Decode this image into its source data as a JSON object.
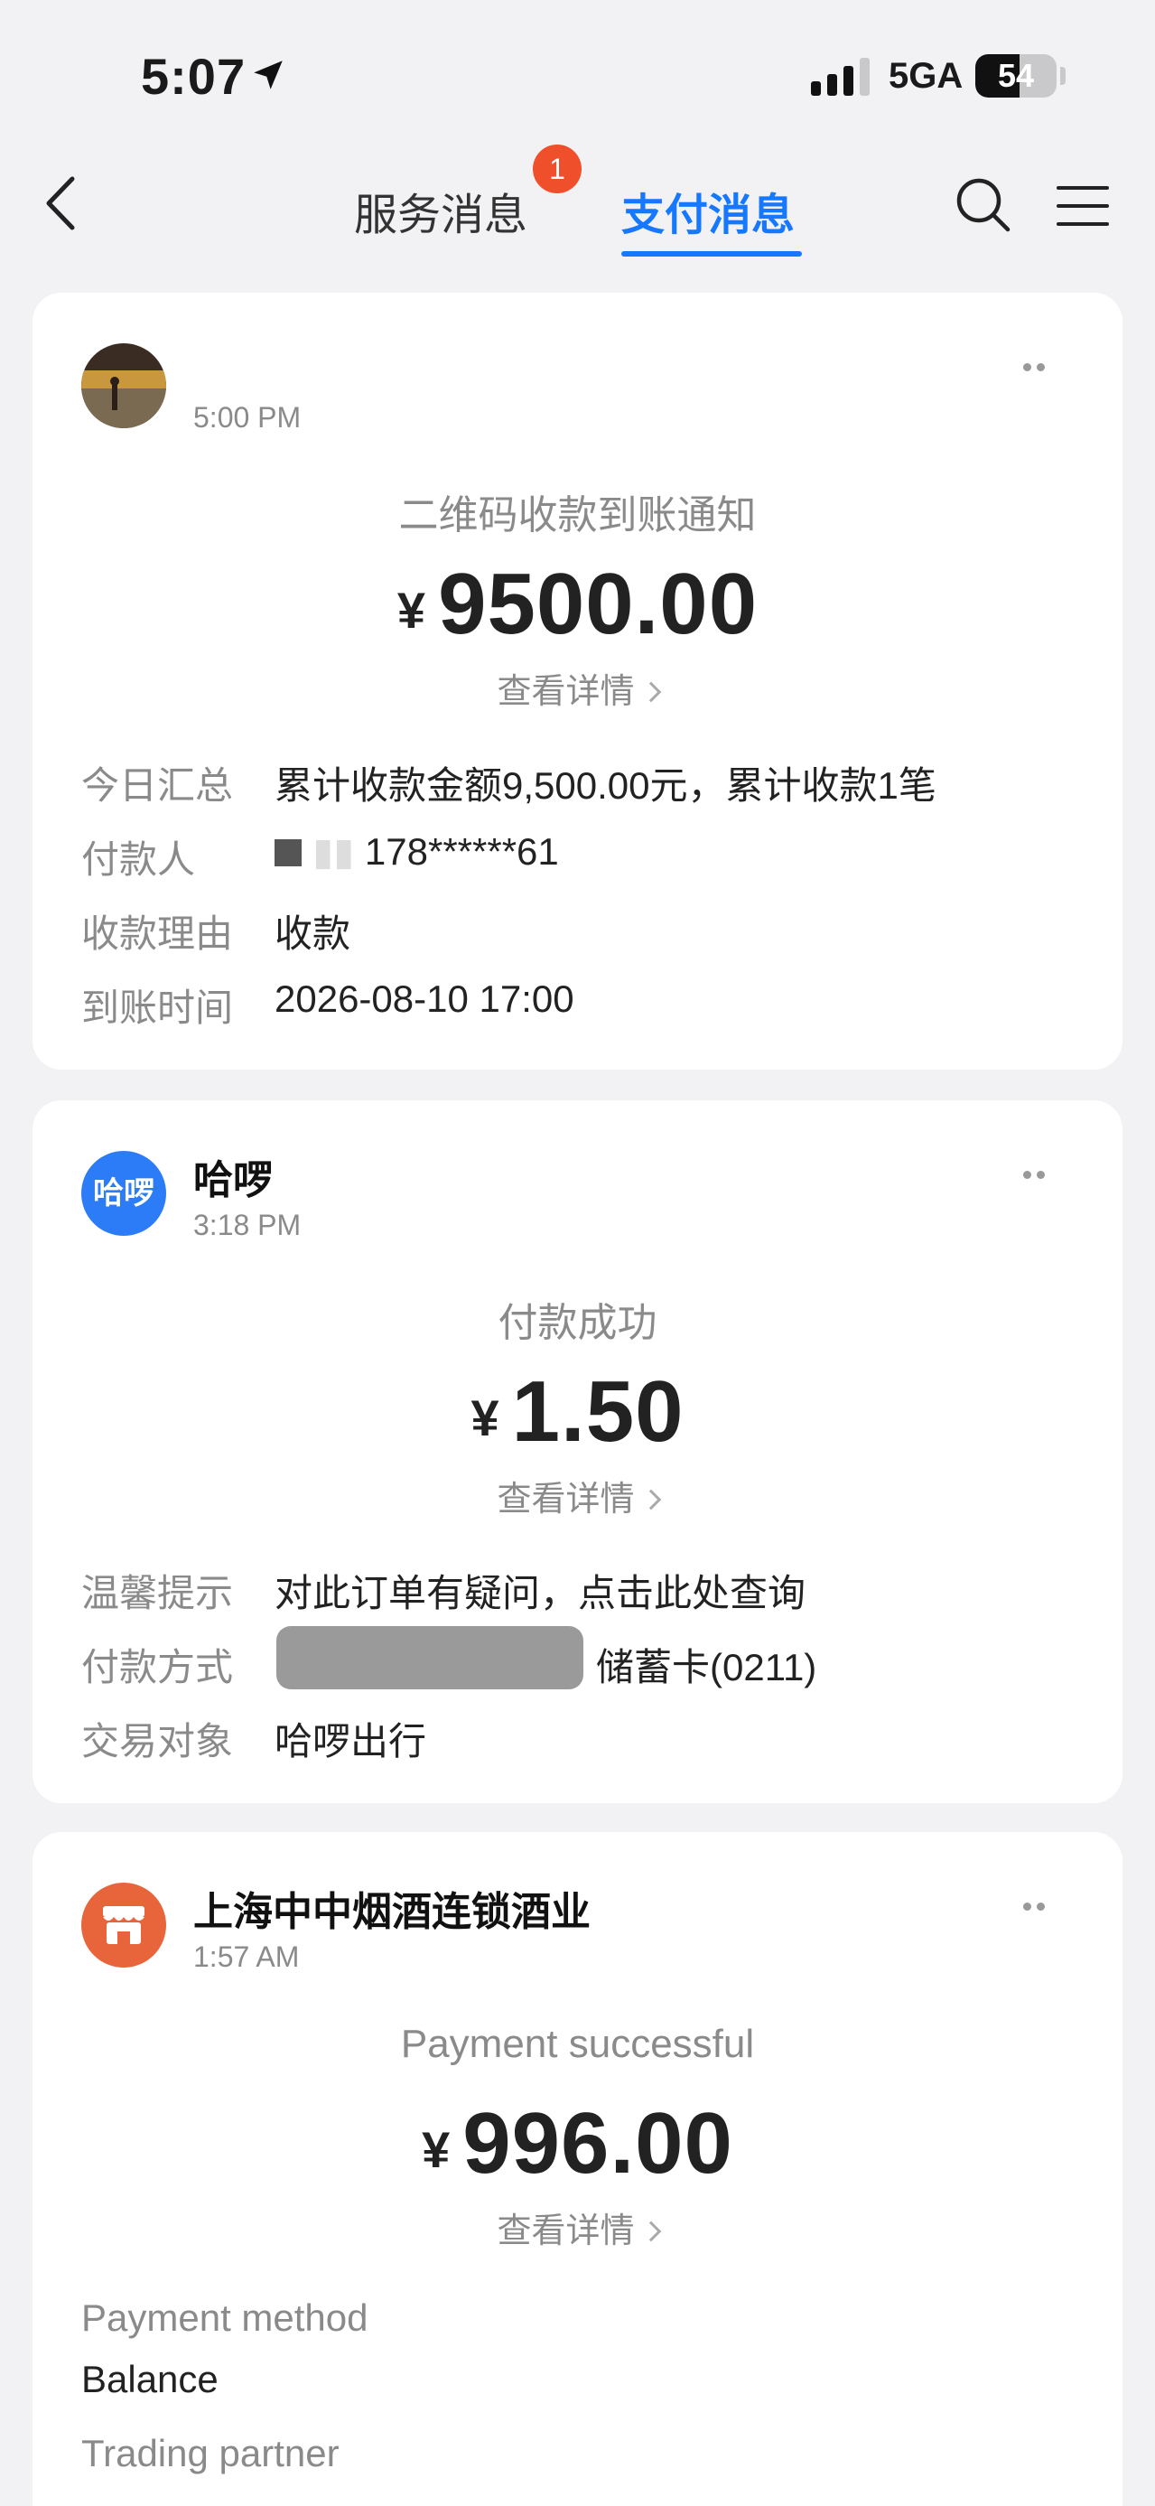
{
  "status_bar": {
    "time": "5:07",
    "network": "5GA",
    "battery": "54",
    "battery_level": 0.54
  },
  "nav": {
    "tabs": [
      {
        "label": "服务消息",
        "badge": "1"
      },
      {
        "label": "支付消息"
      }
    ],
    "active_tab": "支付消息"
  },
  "messages": [
    {
      "merchant": "",
      "time": "5:00 PM",
      "title": "二维码收款到账通知",
      "currency": "¥",
      "amount": "9500.00",
      "details_link": "查看详情",
      "rows": [
        {
          "label": "今日汇总",
          "value": "累计收款金额9,500.00元，累计收款1笔"
        },
        {
          "label": "付款人",
          "value": "178******61"
        },
        {
          "label": "收款理由",
          "value": "收款"
        },
        {
          "label": "到账时间",
          "value": "2026-08-10 17:00"
        }
      ]
    },
    {
      "merchant": "哈啰",
      "avatar_text": "哈啰",
      "time": "3:18 PM",
      "title": "付款成功",
      "currency": "¥",
      "amount": "1.50",
      "details_link": "查看详情",
      "rows": [
        {
          "label": "温馨提示",
          "value": "对此订单有疑问，点击此处查询"
        },
        {
          "label": "付款方式",
          "value": "储蓄卡(0211)"
        },
        {
          "label": "交易对象",
          "value": "哈啰出行"
        }
      ]
    },
    {
      "merchant": "上海中中烟酒连锁酒业",
      "time": "1:57 AM",
      "title": "Payment successful",
      "currency": "¥",
      "amount": "996.00",
      "details_link": "查看详情",
      "rows": [
        {
          "label": "Payment method",
          "value": "Balance"
        },
        {
          "label": "Trading partner",
          "value": ""
        }
      ]
    }
  ],
  "colors": {
    "accent": "#1677ff",
    "badge": "#f04f2b",
    "background": "#f2f2f4",
    "halo_avatar": "#2b7cf6",
    "shop_avatar": "#e8643a"
  }
}
